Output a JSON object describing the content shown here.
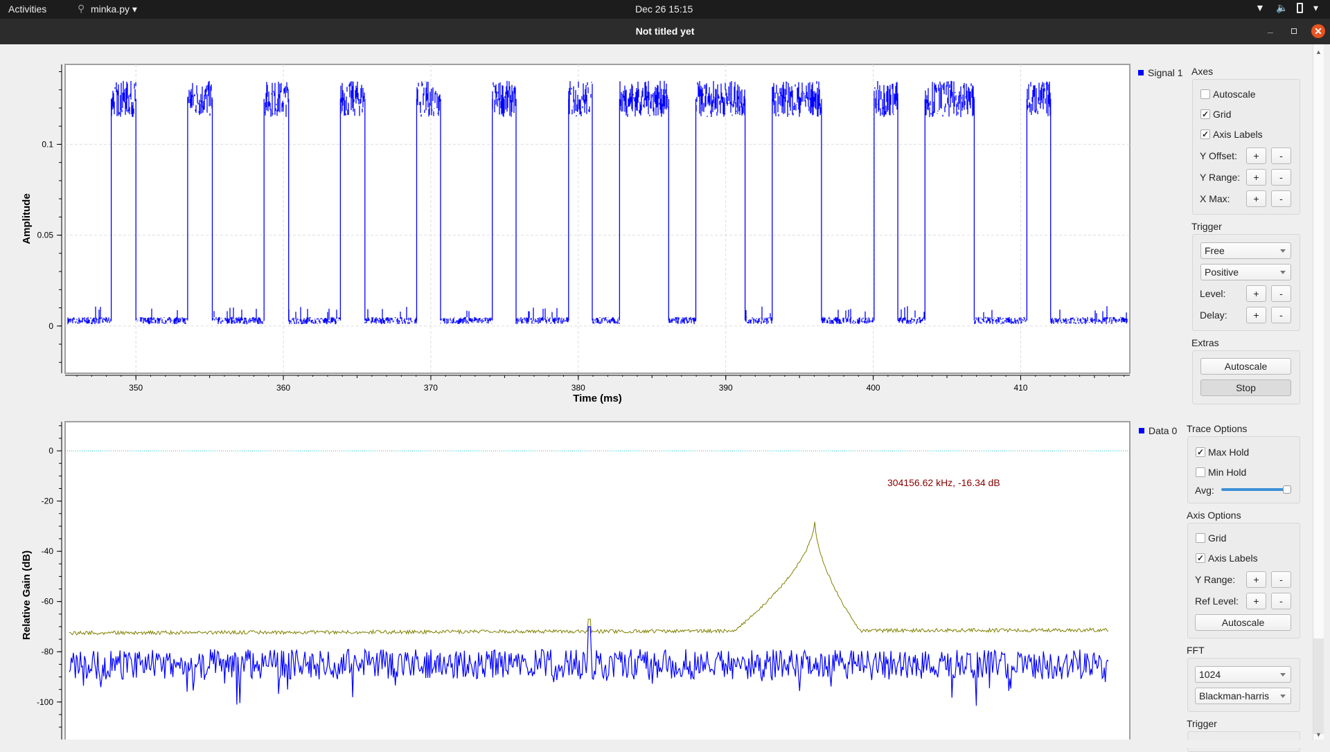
{
  "topbar": {
    "activities": "Activities",
    "app_name": "minka.py",
    "clock": "Dec 26  15:15",
    "icons": [
      "wifi-icon",
      "volume-icon",
      "battery-icon",
      "system-menu-chevron-icon"
    ]
  },
  "window": {
    "title": "Not titled yet",
    "controls": [
      "minimize",
      "maximize",
      "close"
    ],
    "close_color": "#e95420"
  },
  "time_panel": {
    "legend": "Signal 1",
    "axes": {
      "title": "Axes",
      "autoscale": {
        "label": "Autoscale",
        "checked": false
      },
      "grid": {
        "label": "Grid",
        "checked": true
      },
      "axis_labels": {
        "label": "Axis Labels",
        "checked": true
      },
      "y_offset": "Y Offset:",
      "y_range": "Y Range:",
      "x_max": "X Max:",
      "plus": "+",
      "minus": "-"
    },
    "trigger": {
      "title": "Trigger",
      "mode": "Free",
      "slope": "Positive",
      "level": "Level:",
      "delay": "Delay:"
    },
    "extras": {
      "title": "Extras",
      "autoscale": "Autoscale",
      "stop": "Stop"
    }
  },
  "freq_panel": {
    "legend": "Data 0",
    "trace": {
      "title": "Trace Options",
      "max_hold": {
        "label": "Max Hold",
        "checked": true
      },
      "min_hold": {
        "label": "Min Hold",
        "checked": false
      },
      "avg": "Avg:",
      "avg_value": 0.95
    },
    "axis": {
      "title": "Axis Options",
      "grid": {
        "label": "Grid",
        "checked": false
      },
      "axis_labels": {
        "label": "Axis Labels",
        "checked": true
      },
      "y_range": "Y Range:",
      "ref_level": "Ref Level:",
      "autoscale": "Autoscale"
    },
    "fft": {
      "title": "FFT",
      "size": "1024",
      "window": "Blackman-harris"
    },
    "trigger": {
      "title": "Trigger"
    }
  },
  "chart_data": [
    {
      "type": "line",
      "title": "",
      "xlabel": "Time (ms)",
      "ylabel": "Amplitude",
      "xlim": [
        345.2,
        417.4
      ],
      "ylim": [
        -0.026,
        0.144
      ],
      "xticks": [
        "350",
        "360",
        "370",
        "380",
        "390",
        "400",
        "410"
      ],
      "yticks": [
        "0",
        "0.05",
        "0.1"
      ],
      "grid": true,
      "series": [
        {
          "name": "Signal 1",
          "color": "#0000ff",
          "low_level": 0.003,
          "high_level": 0.125,
          "pulses_ms": [
            [
              348.33,
              350.0
            ],
            [
              353.51,
              355.18
            ],
            [
              358.69,
              360.36
            ],
            [
              363.87,
              365.53
            ],
            [
              369.04,
              370.66
            ],
            [
              374.17,
              375.78
            ],
            [
              379.34,
              380.95
            ],
            [
              382.8,
              386.13
            ],
            [
              387.97,
              391.31
            ],
            [
              393.15,
              396.49
            ],
            [
              400.06,
              401.67
            ],
            [
              403.51,
              406.85
            ],
            [
              410.42,
              412.03
            ]
          ]
        }
      ]
    },
    {
      "type": "line",
      "title": "",
      "xlabel": "",
      "ylabel": "Relative Gain (dB)",
      "ylim": [
        -115.5,
        11.6
      ],
      "yticks": [
        "0",
        "-20",
        "-40",
        "-60",
        "-80",
        "-100"
      ],
      "grid": false,
      "reference_line_db": 0,
      "reference_color": "#00c0c0",
      "marker_label": "304156.62 kHz, -16.34 dB",
      "marker_color": "#8b0000",
      "series": [
        {
          "name": "Max Hold",
          "color": "#808000",
          "floor_db": -72.5,
          "peaks": [
            {
              "bin": 734,
              "db": -28
            },
            {
              "bin": 512,
              "db": -67
            }
          ]
        },
        {
          "name": "Data 0",
          "color": "#0000ff",
          "floor_db": -85,
          "peaks": [
            {
              "bin": 734,
              "db": -78
            },
            {
              "bin": 512,
              "db": -70
            }
          ]
        }
      ],
      "bins": 1024
    }
  ]
}
